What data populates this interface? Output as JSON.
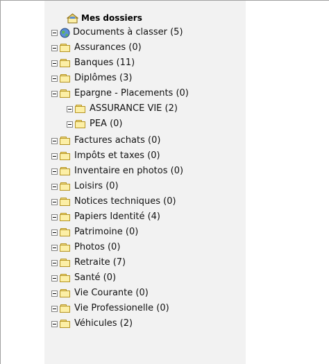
{
  "tree": {
    "root_label": "Mes dossiers",
    "items": [
      {
        "label": "Documents à classer (5)",
        "icon": "globe-icon"
      },
      {
        "label": "Assurances (0)",
        "icon": "folder-icon"
      },
      {
        "label": "Banques (11)",
        "icon": "folder-icon"
      },
      {
        "label": "Diplômes (3)",
        "icon": "folder-icon"
      },
      {
        "label": "Epargne - Placements (0)",
        "icon": "folder-icon",
        "children": [
          {
            "label": "ASSURANCE VIE (2)",
            "icon": "folder-icon"
          },
          {
            "label": "PEA (0)",
            "icon": "folder-icon"
          }
        ]
      },
      {
        "label": "Factures achats (0)",
        "icon": "folder-icon"
      },
      {
        "label": "Impôts et taxes (0)",
        "icon": "folder-icon"
      },
      {
        "label": "Inventaire en photos (0)",
        "icon": "folder-icon"
      },
      {
        "label": "Loisirs (0)",
        "icon": "folder-icon"
      },
      {
        "label": "Notices techniques (0)",
        "icon": "folder-icon"
      },
      {
        "label": "Papiers Identité (4)",
        "icon": "folder-icon"
      },
      {
        "label": "Patrimoine (0)",
        "icon": "folder-icon"
      },
      {
        "label": "Photos (0)",
        "icon": "folder-icon"
      },
      {
        "label": "Retraite (7)",
        "icon": "folder-icon"
      },
      {
        "label": "Santé (0)",
        "icon": "folder-icon"
      },
      {
        "label": "Vie Courante (0)",
        "icon": "folder-icon"
      },
      {
        "label": "Vie Professionelle (0)",
        "icon": "folder-icon"
      },
      {
        "label": "Véhicules (2)",
        "icon": "folder-icon"
      }
    ]
  },
  "colors": {
    "tree_background": "#f2f2f2",
    "folder_fill": "#fcefa6",
    "folder_stroke": "#b59320"
  }
}
